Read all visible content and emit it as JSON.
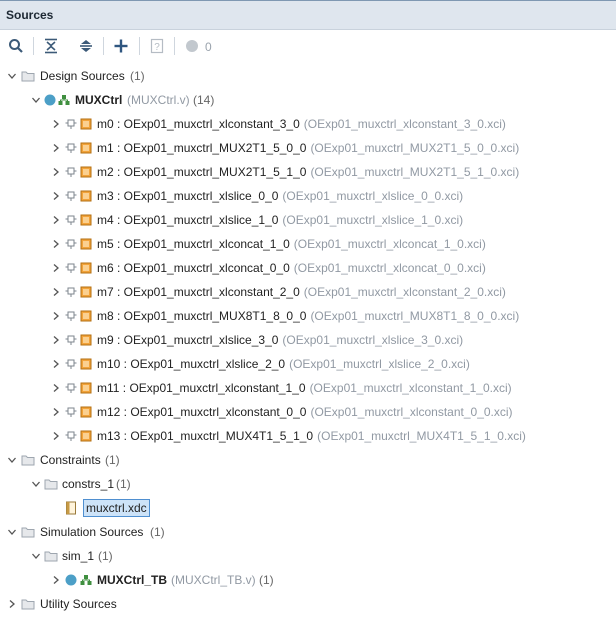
{
  "panel": {
    "title": "Sources"
  },
  "toolbar": {
    "buttons": [
      "search-icon",
      "collapse-all-icon",
      "expand-all-icon",
      "add-sources-icon",
      "properties-icon",
      "status-dot-icon"
    ],
    "status_count": "0"
  },
  "tree": {
    "design": {
      "label": "Design Sources",
      "count": "(1)"
    },
    "top": {
      "name": "MUXCtrl",
      "file": "(MUXCtrl.v)",
      "count": "(14)"
    },
    "modules": [
      {
        "inst": "m0 : OExp01_muxctrl_xlconstant_3_0",
        "file": "(OExp01_muxctrl_xlconstant_3_0.xci)"
      },
      {
        "inst": "m1 : OExp01_muxctrl_MUX2T1_5_0_0",
        "file": "(OExp01_muxctrl_MUX2T1_5_0_0.xci)"
      },
      {
        "inst": "m2 : OExp01_muxctrl_MUX2T1_5_1_0",
        "file": "(OExp01_muxctrl_MUX2T1_5_1_0.xci)"
      },
      {
        "inst": "m3 : OExp01_muxctrl_xlslice_0_0",
        "file": "(OExp01_muxctrl_xlslice_0_0.xci)"
      },
      {
        "inst": "m4 : OExp01_muxctrl_xlslice_1_0",
        "file": "(OExp01_muxctrl_xlslice_1_0.xci)"
      },
      {
        "inst": "m5 : OExp01_muxctrl_xlconcat_1_0",
        "file": "(OExp01_muxctrl_xlconcat_1_0.xci)"
      },
      {
        "inst": "m6 : OExp01_muxctrl_xlconcat_0_0",
        "file": "(OExp01_muxctrl_xlconcat_0_0.xci)"
      },
      {
        "inst": "m7 : OExp01_muxctrl_xlconstant_2_0",
        "file": "(OExp01_muxctrl_xlconstant_2_0.xci)"
      },
      {
        "inst": "m8 : OExp01_muxctrl_MUX8T1_8_0_0",
        "file": "(OExp01_muxctrl_MUX8T1_8_0_0.xci)"
      },
      {
        "inst": "m9 : OExp01_muxctrl_xlslice_3_0",
        "file": "(OExp01_muxctrl_xlslice_3_0.xci)"
      },
      {
        "inst": "m10 : OExp01_muxctrl_xlslice_2_0",
        "file": "(OExp01_muxctrl_xlslice_2_0.xci)"
      },
      {
        "inst": "m11 : OExp01_muxctrl_xlconstant_1_0",
        "file": "(OExp01_muxctrl_xlconstant_1_0.xci)"
      },
      {
        "inst": "m12 : OExp01_muxctrl_xlconstant_0_0",
        "file": "(OExp01_muxctrl_xlconstant_0_0.xci)"
      },
      {
        "inst": "m13 : OExp01_muxctrl_MUX4T1_5_1_0",
        "file": "(OExp01_muxctrl_MUX4T1_5_1_0.xci)"
      }
    ],
    "constraints": {
      "label": "Constraints",
      "count": "(1)"
    },
    "constrs": {
      "label": "constrs_1",
      "count": "(1)"
    },
    "xdc": {
      "label": "muxctrl.xdc"
    },
    "simulation": {
      "label": "Simulation Sources",
      "count": "(1)"
    },
    "sim": {
      "label": "sim_1",
      "count": "(1)"
    },
    "tb": {
      "name": "MUXCtrl_TB",
      "file": "(MUXCtrl_TB.v)",
      "count": "(1)"
    },
    "utility": {
      "label": "Utility Sources"
    }
  },
  "colors": {
    "header_bg": "#dfe6ee",
    "module_icon": "#f2a33a",
    "status_dot": "#4c9fc7",
    "selection_bg": "#cde3f8",
    "selection_border": "#4f8fd0"
  }
}
